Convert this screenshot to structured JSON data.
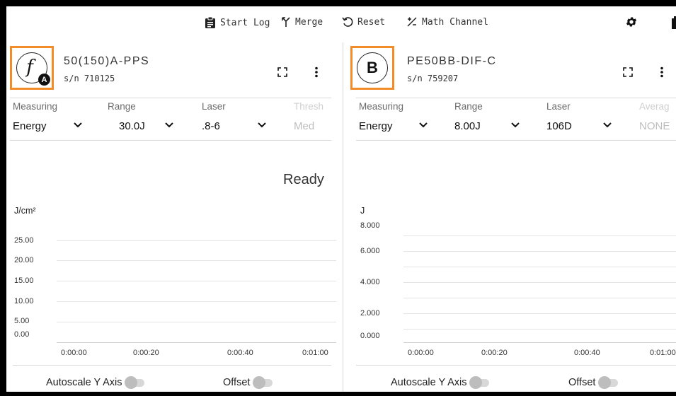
{
  "toolbar": {
    "start_log": "Start Log",
    "merge": "Merge",
    "reset": "Reset",
    "math_channel": "Math Channel",
    "settings_icon": "gear-icon"
  },
  "channel_a": {
    "badge_glyph": "f",
    "badge_sub": "A",
    "name": "50(150)A-PPS",
    "serial": "s/n 710125",
    "fields": [
      {
        "label": "Measuring",
        "value": "Energy"
      },
      {
        "label": "Range",
        "value": "30.0J"
      },
      {
        "label": "Laser",
        "value": ".8-6"
      },
      {
        "label": "Thresh",
        "value": "Med"
      }
    ],
    "status": "Ready",
    "unit": "J/cm²",
    "y_ticks": [
      "25.00",
      "20.00",
      "15.00",
      "10.00",
      "5.00",
      "0.00"
    ],
    "x_ticks": [
      "0:00:00",
      "0:00:20",
      "0:00:40",
      "0:01:00"
    ],
    "autoscale_label": "Autoscale Y Axis",
    "offset_label": "Offset",
    "autoscale_on": false,
    "offset_on": false
  },
  "channel_b": {
    "badge_glyph": "B",
    "name": "PE50BB-DIF-C",
    "serial": "s/n 759207",
    "fields": [
      {
        "label": "Measuring",
        "value": "Energy"
      },
      {
        "label": "Range",
        "value": "8.00J"
      },
      {
        "label": "Laser",
        "value": "106D"
      },
      {
        "label": "Averag",
        "value": "NONE"
      }
    ],
    "unit": "J",
    "y_ticks": [
      "8.000",
      "6.000",
      "4.000",
      "2.000",
      "0.000"
    ],
    "x_ticks": [
      "0:00:00",
      "0:00:20",
      "0:00:40",
      "0:01:00"
    ],
    "autoscale_label": "Autoscale Y Axis",
    "offset_label": "Offset",
    "autoscale_on": false,
    "offset_on": false
  },
  "colors": {
    "badge_highlight": "#f28c28",
    "toggle_off": "#bdbdbd"
  }
}
